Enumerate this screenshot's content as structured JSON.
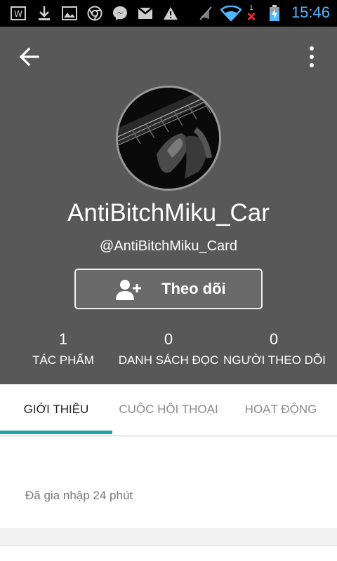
{
  "status_bar": {
    "time": "15:46",
    "icons": [
      "w-icon",
      "download-icon",
      "image-icon",
      "chrome-icon",
      "messenger-icon",
      "gmail-icon",
      "warning-icon",
      "mute-icon",
      "wifi-icon",
      "no-signal-icon",
      "battery-charging-icon"
    ],
    "signal_badge": "1"
  },
  "profile": {
    "display_name": "AntiBitchMiku_Car",
    "username": "@AntiBitchMiku_Card",
    "follow_label": "Theo dõi",
    "stats": [
      {
        "value": "1",
        "label": "TÁC PHẨM"
      },
      {
        "value": "0",
        "label": "DANH SÁCH ĐỌC"
      },
      {
        "value": "0",
        "label": "NGƯỜI THEO DÕI"
      }
    ]
  },
  "tabs": [
    {
      "label": "GIỚI THIỆU",
      "active": true
    },
    {
      "label": "CUỘC HỘI THOẠI",
      "active": false
    },
    {
      "label": "HOẠT ĐỘNG",
      "active": false
    }
  ],
  "about": {
    "joined": "Đã gia nhập 24 phút"
  },
  "colors": {
    "header_bg": "#585858",
    "tab_indicator": "#16a8a4",
    "clock": "#4fb8ff"
  }
}
